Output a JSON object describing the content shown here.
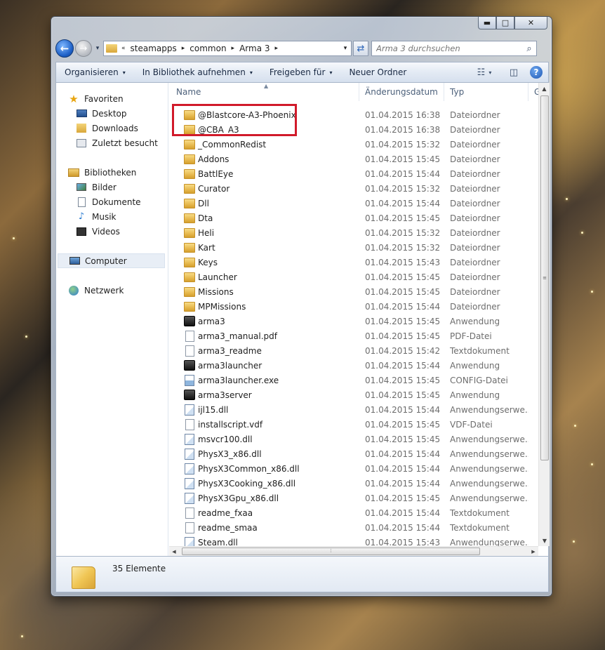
{
  "window": {
    "caption": {
      "minimize": "▬",
      "maximize": "□",
      "close": "✕"
    }
  },
  "address": {
    "overflow": "«",
    "crumbs": [
      "steamapps",
      "common",
      "Arma 3"
    ],
    "separator": "▸",
    "dropdown": "▾"
  },
  "search": {
    "placeholder": "Arma 3 durchsuchen"
  },
  "toolbar": {
    "organize": "Organisieren",
    "include_library": "In Bibliothek aufnehmen",
    "share": "Freigeben für",
    "new_folder": "Neuer Ordner",
    "caret": "▾"
  },
  "nav": {
    "favorites": "Favoriten",
    "desktop": "Desktop",
    "downloads": "Downloads",
    "recent": "Zuletzt besucht",
    "libraries": "Bibliotheken",
    "pictures": "Bilder",
    "documents": "Dokumente",
    "music": "Musik",
    "videos": "Videos",
    "computer": "Computer",
    "network": "Netzwerk"
  },
  "columns": {
    "name": "Name",
    "date": "Änderungsdatum",
    "type": "Typ",
    "more": "G",
    "sort_arrow": "▲"
  },
  "files": [
    {
      "name": "@Blastcore-A3-Phoenix",
      "date": "01.04.2015 16:38",
      "type": "Dateiordner",
      "icon": "folder"
    },
    {
      "name": "@CBA_A3",
      "date": "01.04.2015 16:38",
      "type": "Dateiordner",
      "icon": "folder"
    },
    {
      "name": "_CommonRedist",
      "date": "01.04.2015 15:32",
      "type": "Dateiordner",
      "icon": "folder"
    },
    {
      "name": "Addons",
      "date": "01.04.2015 15:45",
      "type": "Dateiordner",
      "icon": "folder"
    },
    {
      "name": "BattlEye",
      "date": "01.04.2015 15:44",
      "type": "Dateiordner",
      "icon": "folder"
    },
    {
      "name": "Curator",
      "date": "01.04.2015 15:32",
      "type": "Dateiordner",
      "icon": "folder"
    },
    {
      "name": "Dll",
      "date": "01.04.2015 15:44",
      "type": "Dateiordner",
      "icon": "folder"
    },
    {
      "name": "Dta",
      "date": "01.04.2015 15:45",
      "type": "Dateiordner",
      "icon": "folder"
    },
    {
      "name": "Heli",
      "date": "01.04.2015 15:32",
      "type": "Dateiordner",
      "icon": "folder"
    },
    {
      "name": "Kart",
      "date": "01.04.2015 15:32",
      "type": "Dateiordner",
      "icon": "folder"
    },
    {
      "name": "Keys",
      "date": "01.04.2015 15:43",
      "type": "Dateiordner",
      "icon": "folder"
    },
    {
      "name": "Launcher",
      "date": "01.04.2015 15:45",
      "type": "Dateiordner",
      "icon": "folder"
    },
    {
      "name": "Missions",
      "date": "01.04.2015 15:45",
      "type": "Dateiordner",
      "icon": "folder"
    },
    {
      "name": "MPMissions",
      "date": "01.04.2015 15:44",
      "type": "Dateiordner",
      "icon": "folder"
    },
    {
      "name": "arma3",
      "date": "01.04.2015 15:45",
      "type": "Anwendung",
      "icon": "app"
    },
    {
      "name": "arma3_manual.pdf",
      "date": "01.04.2015 15:45",
      "type": "PDF-Datei",
      "icon": "doc"
    },
    {
      "name": "arma3_readme",
      "date": "01.04.2015 15:42",
      "type": "Textdokument",
      "icon": "doc"
    },
    {
      "name": "arma3launcher",
      "date": "01.04.2015 15:44",
      "type": "Anwendung",
      "icon": "app"
    },
    {
      "name": "arma3launcher.exe",
      "date": "01.04.2015 15:45",
      "type": "CONFIG-Datei",
      "icon": "cfg"
    },
    {
      "name": "arma3server",
      "date": "01.04.2015 15:45",
      "type": "Anwendung",
      "icon": "app"
    },
    {
      "name": "ijl15.dll",
      "date": "01.04.2015 15:44",
      "type": "Anwendungserwe...",
      "icon": "dll"
    },
    {
      "name": "installscript.vdf",
      "date": "01.04.2015 15:45",
      "type": "VDF-Datei",
      "icon": "doc"
    },
    {
      "name": "msvcr100.dll",
      "date": "01.04.2015 15:45",
      "type": "Anwendungserwe...",
      "icon": "dll"
    },
    {
      "name": "PhysX3_x86.dll",
      "date": "01.04.2015 15:44",
      "type": "Anwendungserwe...",
      "icon": "dll"
    },
    {
      "name": "PhysX3Common_x86.dll",
      "date": "01.04.2015 15:44",
      "type": "Anwendungserwe...",
      "icon": "dll"
    },
    {
      "name": "PhysX3Cooking_x86.dll",
      "date": "01.04.2015 15:44",
      "type": "Anwendungserwe...",
      "icon": "dll"
    },
    {
      "name": "PhysX3Gpu_x86.dll",
      "date": "01.04.2015 15:45",
      "type": "Anwendungserwe...",
      "icon": "dll"
    },
    {
      "name": "readme_fxaa",
      "date": "01.04.2015 15:44",
      "type": "Textdokument",
      "icon": "doc"
    },
    {
      "name": "readme_smaa",
      "date": "01.04.2015 15:44",
      "type": "Textdokument",
      "icon": "doc"
    },
    {
      "name": "Steam.dll",
      "date": "01.04.2015 15:43",
      "type": "Anwendungserwe...",
      "icon": "dll"
    }
  ],
  "status": {
    "count": "35 Elemente"
  },
  "colors": {
    "highlight": "#d11a2a",
    "accent": "#1d5fc6"
  }
}
